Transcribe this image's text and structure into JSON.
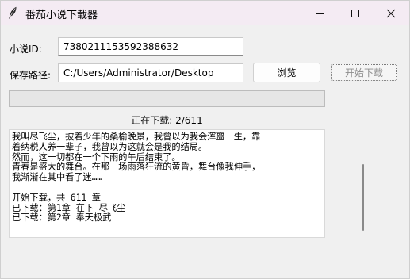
{
  "window": {
    "title": "番茄小说下载器",
    "icon": "feather-icon"
  },
  "form": {
    "novel_id_label": "小说ID:",
    "novel_id_value": "7380211153592388632",
    "save_path_label": "保存路径:",
    "save_path_value": "C:/Users/Administrator/Desktop",
    "browse_label": "浏览",
    "start_label": "开始下载"
  },
  "progress": {
    "completed": 2,
    "total": 611,
    "fraction": 0.0033,
    "status_text": "正在下载: 2/611",
    "color": "#06b025"
  },
  "log": {
    "lines": [
      "我叫尽飞尘，披着少年的桑榆晚景，我曾以为我会浑噩一生，靠",
      "着纳税人养一辈子，我曾以为这就会是我的结局。",
      "然而，这一切都在一个下雨的午后结束了。",
      "青春是盛大的舞台。在那一场雨落狂流的黄昏，舞台像我伸手，",
      "我渐渐在其中看了迷……",
      "",
      "开始下载，共 611 章",
      "已下载：第1章 在下 尽飞尘",
      "已下载：第2章 奉天极武"
    ]
  }
}
